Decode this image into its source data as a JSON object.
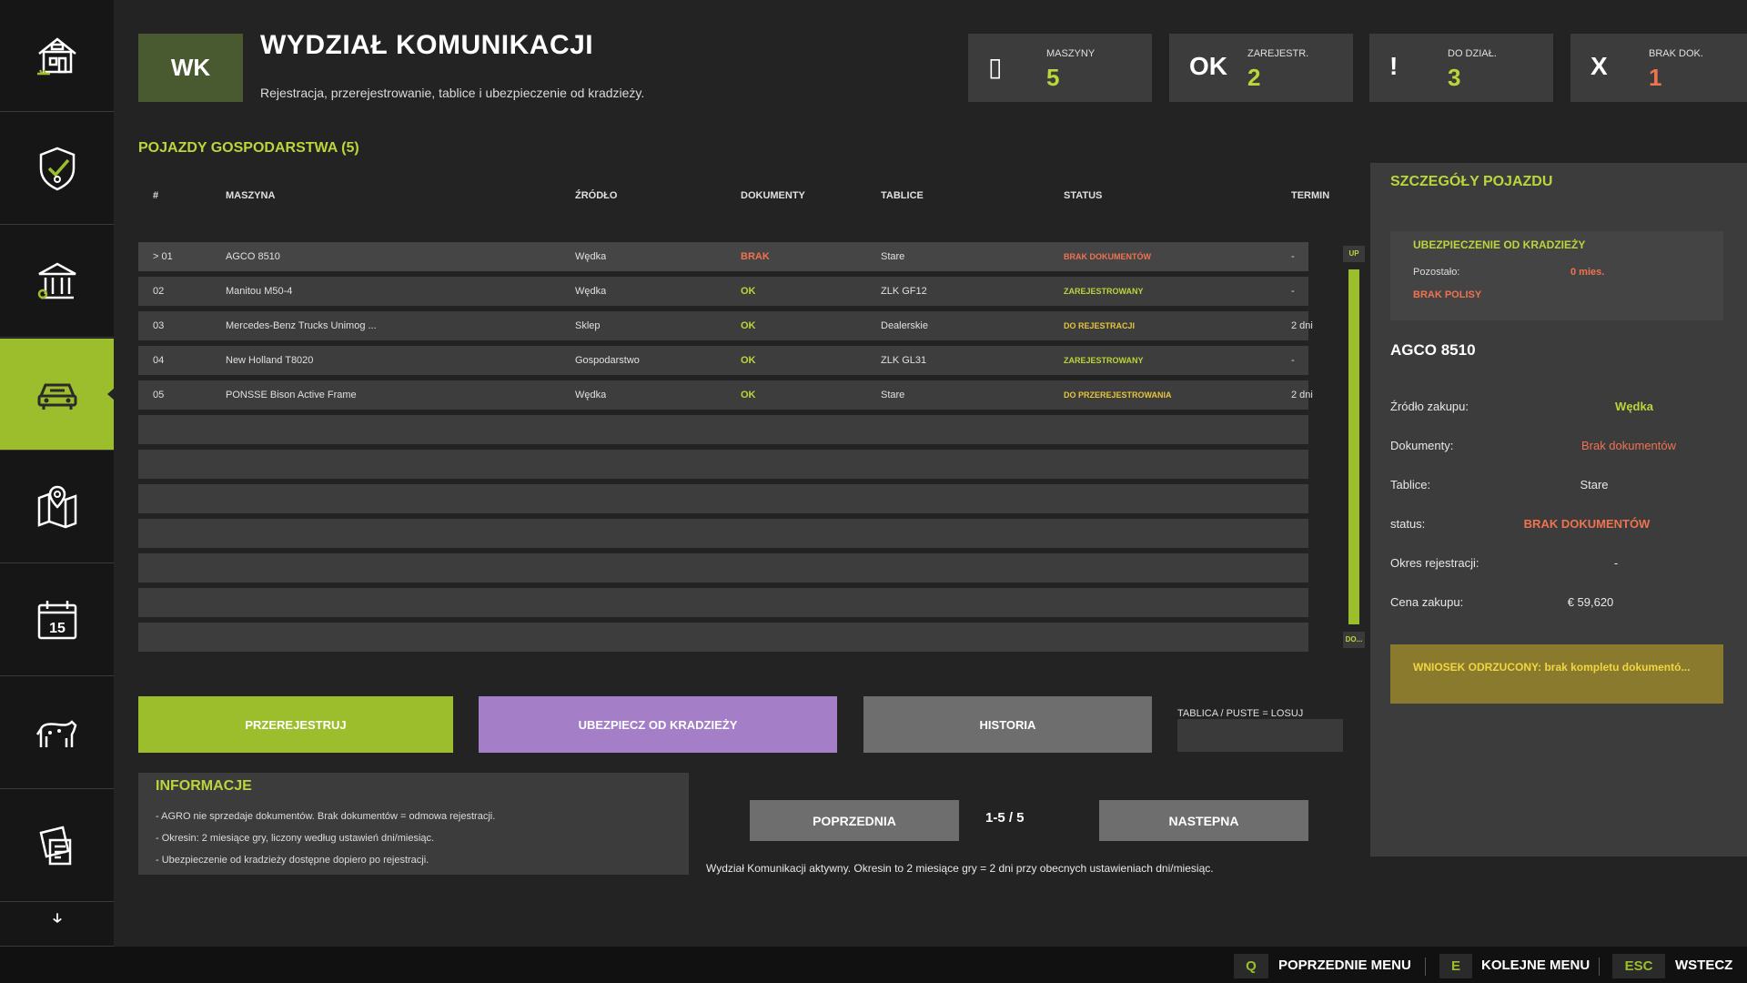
{
  "header": {
    "badge": "WK",
    "title": "WYDZIAŁ KOMUNIKACJI",
    "subtitle": "Rejestracja, przerejestrowanie, tablice i ubezpieczenie od kradzieży."
  },
  "stats": [
    {
      "symbol": "▯",
      "label": "MASZYNY",
      "value": "5",
      "color": "#b9d63a"
    },
    {
      "symbol": "OK",
      "label": "ZAREJESTR.",
      "value": "2",
      "color": "#b9d63a"
    },
    {
      "symbol": "!",
      "label": "DO DZIAŁ.",
      "value": "3",
      "color": "#b9d63a"
    },
    {
      "symbol": "X",
      "label": "BRAK DOK.",
      "value": "1",
      "color": "#ef7350"
    }
  ],
  "sidebar": {
    "items": [
      {
        "icon": "farm-house-icon"
      },
      {
        "icon": "shield-check-icon"
      },
      {
        "icon": "bank-icon"
      },
      {
        "icon": "vehicle-icon",
        "active": true
      },
      {
        "icon": "map-icon"
      },
      {
        "icon": "calendar-icon",
        "day": "15"
      },
      {
        "icon": "animals-icon"
      },
      {
        "icon": "contracts-icon"
      },
      {
        "icon": "more-icon"
      }
    ]
  },
  "table": {
    "section_title": "POJAZDY GOSPODARSTWA (5)",
    "headers": [
      "#",
      "MASZYNA",
      "ŹRÓDŁO",
      "DOKUMENTY",
      "TABLICE",
      "STATUS",
      "TERMIN"
    ],
    "rows": [
      {
        "num": "> 01",
        "machine": "AGCO 8510",
        "source": "Wędka",
        "docs": "BRAK",
        "docs_color": "red",
        "plates": "Stare",
        "status": "BRAK DOKUMENTÓW",
        "status_color": "red",
        "deadline": "-"
      },
      {
        "num": "02",
        "machine": "Manitou M50-4",
        "source": "Wędka",
        "docs": "OK",
        "docs_color": "green",
        "plates": "ZLK GF12",
        "status": "ZAREJESTROWANY",
        "status_color": "green",
        "deadline": "-"
      },
      {
        "num": "03",
        "machine": "Mercedes-Benz Trucks Unimog ...",
        "source": "Sklep",
        "docs": "OK",
        "docs_color": "green",
        "plates": "Dealerskie",
        "status": "DO REJESTRACJI",
        "status_color": "yellow",
        "deadline": "2 dni"
      },
      {
        "num": "04",
        "machine": "New Holland T8020",
        "source": "Gospodarstwo",
        "docs": "OK",
        "docs_color": "green",
        "plates": "ZLK GL31",
        "status": "ZAREJESTROWANY",
        "status_color": "green",
        "deadline": "-"
      },
      {
        "num": "05",
        "machine": "PONSSE Bison Active Frame",
        "source": "Wędka",
        "docs": "OK",
        "docs_color": "green",
        "plates": "Stare",
        "status": "DO PRZEREJESTROWANIA",
        "status_color": "yellow",
        "deadline": "2 dni"
      }
    ],
    "scroll_up": "UP",
    "scroll_down": "DO..."
  },
  "actions": {
    "reregister": "PRZEREJESTRUJ",
    "insure": "UBEZPIECZ OD KRADZIEŻY",
    "history": "HISTORIA",
    "plate_label": "TABLICA / PUSTE = LOSUJ",
    "plate_value": ""
  },
  "info": {
    "title": "INFORMACJE",
    "lines": [
      "- AGRO nie sprzedaje dokumentów. Brak dokumentów = odmowa rejestracji.",
      "- Okresin: 2 miesiące gry, liczony według ustawień dni/miesiąc.",
      "- Ubezpieczenie od kradzieży dostępne dopiero po rejestracji."
    ]
  },
  "pager": {
    "prev": "POPRZEDNIA",
    "range": "1-5 / 5",
    "next": "NASTEPNA"
  },
  "status_line": "Wydział Komunikacji aktywny. Okresin to 2 miesiące gry = 2 dni przy obecnych ustawieniach dni/miesiąc.",
  "details": {
    "title": "SZCZEGÓŁY POJAZDU",
    "insurance_title": "UBEZPIECZENIE OD KRADZIEŻY",
    "remaining_label": "Pozostało:",
    "remaining_value": "0 mies.",
    "no_policy": "BRAK POLISY",
    "vehicle": "AGCO 8510",
    "fields": [
      {
        "label": "Źródło zakupu:",
        "value": "Wędka",
        "color": "green"
      },
      {
        "label": "Dokumenty:",
        "value": "Brak dokumentów",
        "color": "red"
      },
      {
        "label": "Tablice:",
        "value": "Stare",
        "color": "plain"
      },
      {
        "label": "status:",
        "value": "BRAK DOKUMENTÓW",
        "color": "red"
      },
      {
        "label": "Okres rejestracji:",
        "value": "-",
        "color": "plain"
      },
      {
        "label": "Cena zakupu:",
        "value": "€ 59,620",
        "color": "plain"
      }
    ],
    "rejected": "WNIOSEK ODRZUCONY: brak kompletu dokumentó..."
  },
  "footer": {
    "keys": [
      {
        "key": "Q",
        "label": "POPRZEDNIE MENU"
      },
      {
        "key": "E",
        "label": "KOLEJNE MENU"
      },
      {
        "key": "ESC",
        "label": "WSTECZ"
      }
    ]
  },
  "colors": {
    "accent": "#9dbe2c",
    "accent_text": "#b9d63a",
    "red": "#ef7350",
    "yellow": "#e6c53a",
    "purple": "#a47ec6"
  }
}
